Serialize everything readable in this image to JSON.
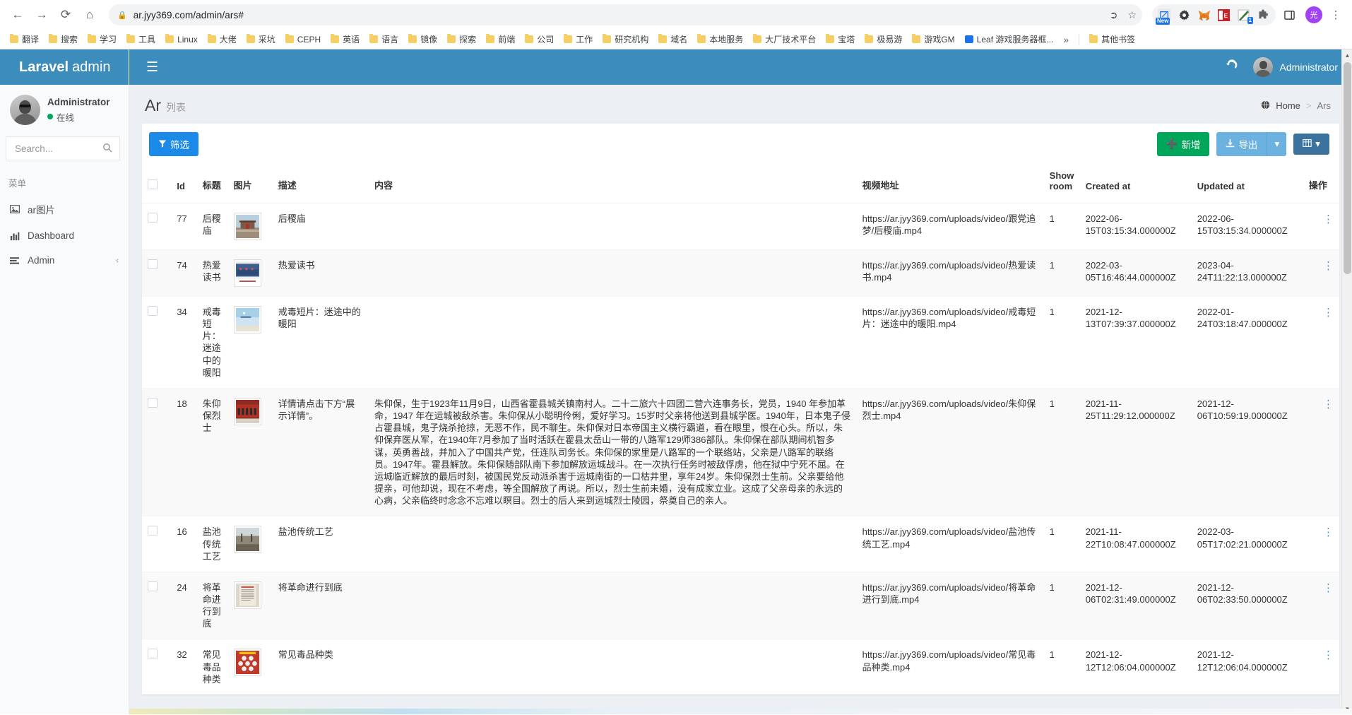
{
  "browser": {
    "url": "ar.jyy369.com/admin/ars#",
    "nav": {
      "back": "←",
      "forward": "→",
      "reload": "⟳",
      "home": "⌂"
    },
    "lock_icon": "lock-icon",
    "share_icon": "share-icon",
    "bookmark_star_icon": "star-icon",
    "extensions": [
      "new-tab-extension",
      "gear-extension",
      "metamask-fox-extension",
      "pdf-extension",
      "marker-extension",
      "puzzle-extension"
    ],
    "sidepanel_icon": "side-panel-icon",
    "profile_initial": "光",
    "menu_icon": "kebab-menu-icon",
    "bookmarks": [
      "翻译",
      "搜索",
      "学习",
      "工具",
      "Linux",
      "大佬",
      "采坑",
      "CEPH",
      "英语",
      "语言",
      "镜像",
      "探索",
      "前端",
      "公司",
      "工作",
      "研究机构",
      "域名",
      "本地服务",
      "大厂技术平台",
      "宝塔",
      "极易游",
      "游戏GM",
      "Leaf 游戏服务器框..."
    ],
    "bookmarks_overflow": "»",
    "other_bookmarks": "其他书签"
  },
  "sidebar": {
    "brand_bold": "Laravel",
    "brand_rest": "admin",
    "user": {
      "name": "Administrator",
      "status": "在线"
    },
    "search": {
      "placeholder": "Search...",
      "value": ""
    },
    "menu_header": "菜单",
    "items": [
      {
        "label": "ar图片",
        "icon": "image-icon",
        "has_children": false
      },
      {
        "label": "Dashboard",
        "icon": "chart-bar-icon",
        "has_children": false
      },
      {
        "label": "Admin",
        "icon": "list-icon",
        "has_children": true
      }
    ]
  },
  "topbar": {
    "hamburger": "☰",
    "refresh_icon": "refresh-icon",
    "username": "Administrator"
  },
  "page": {
    "title": "Ar",
    "subtitle": "列表",
    "breadcrumb": {
      "home": "Home",
      "separator": ">",
      "current": "Ars"
    }
  },
  "toolbar": {
    "filter_label": "筛选",
    "filter_icon": "funnel-icon",
    "add_label": "新增",
    "add_icon": "plus-icon",
    "export_label": "导出",
    "export_icon": "download-icon",
    "export_caret": "▾",
    "grid_icon": "grid-icon",
    "grid_caret": "▾"
  },
  "table": {
    "headers": {
      "select": "",
      "id": "Id",
      "title": "标题",
      "image": "图片",
      "description": "描述",
      "content": "内容",
      "video_url": "视频地址",
      "show_room": "Show room",
      "created_at": "Created at",
      "updated_at": "Updated at",
      "operations": "操作"
    },
    "rows": [
      {
        "id": "77",
        "title": "后稷庙",
        "image": "houji-temple-thumbnail",
        "description": "后稷庙",
        "content": "",
        "video_url": "https://ar.jyy369.com/uploads/video/跟党追梦/后稷庙.mp4",
        "show_room": "1",
        "created_at": "2022-06-15T03:15:34.000000Z",
        "updated_at": "2022-06-15T03:15:34.000000Z",
        "ops": "⋮"
      },
      {
        "id": "74",
        "title": "热爱读书",
        "image": "reading-classroom-thumbnail",
        "description": "热爱读书",
        "content": "",
        "video_url": "https://ar.jyy369.com/uploads/video/热爱读书.mp4",
        "show_room": "1",
        "created_at": "2022-03-05T16:46:44.000000Z",
        "updated_at": "2023-04-24T11:22:13.000000Z",
        "ops": "⋮"
      },
      {
        "id": "34",
        "title": "戒毒短片：迷途中的暖阳",
        "image": "sky-poster-thumbnail",
        "description": "戒毒短片：迷途中的暖阳",
        "content": "",
        "video_url": "https://ar.jyy369.com/uploads/video/戒毒短片：迷途中的暖阳.mp4",
        "show_room": "1",
        "created_at": "2021-12-13T07:39:37.000000Z",
        "updated_at": "2022-01-24T03:18:47.000000Z",
        "ops": "⋮"
      },
      {
        "id": "18",
        "title": "朱仰保烈士",
        "image": "group-photo-thumbnail",
        "description": "详情请点击下方“展示详情”。",
        "content": "朱仰保，生于1923年11月9日，山西省霍县城关镇南村人。二十二旅六十四团二营六连事务长，党员，1940 年参加革命，1947 年在运城被敌杀害。朱仰保从小聪明伶俐，爱好学习。15岁时父亲将他送到县城学医。1940年，日本鬼子侵占霍县城，鬼子烧杀抢掠，无恶不作，民不聊生。朱仰保对日本帝国主义横行霸道，看在眼里，恨在心头。所以，朱仰保弃医从军，在1940年7月参加了当时活跃在霍县太岳山一带的八路军129师386部队。朱仰保在部队期间机智多谋，英勇善战，并加入了中国共产党，任连队司务长。朱仰保的家里是八路军的一个联络站，父亲是八路军的联络员。1947年。霍县解放。朱仰保随部队南下参加解放运城战斗。在一次执行任务时被敌俘虏，他在狱中宁死不屈。在运城临近解放的最后时刻，被国民党反动派杀害于运城南街的一口枯井里，享年24岁。朱仰保烈士生前。父亲要给他提亲，可他却说，现在不考虑，等全国解放了再说。所以，烈士生前未婚，没有成家立业。这成了父亲母亲的永远的心病，父亲临终时念念不忘难以瞑目。烈士的后人来到运城烈士陵园，祭奠自己的亲人。",
        "video_url": "https://ar.jyy369.com/uploads/video/朱仰保烈士.mp4",
        "show_room": "1",
        "created_at": "2021-11-25T11:29:12.000000Z",
        "updated_at": "2021-12-06T10:59:19.000000Z",
        "ops": "⋮"
      },
      {
        "id": "16",
        "title": "盐池传统工艺",
        "image": "salt-lake-thumbnail",
        "description": "盐池传统工艺",
        "content": "",
        "video_url": "https://ar.jyy369.com/uploads/video/盐池传统工艺.mp4",
        "show_room": "1",
        "created_at": "2021-11-22T10:08:47.000000Z",
        "updated_at": "2022-03-05T17:02:21.000000Z",
        "ops": "⋮"
      },
      {
        "id": "24",
        "title": "将革命进行到底",
        "image": "newspaper-thumbnail",
        "description": "将革命进行到底",
        "content": "",
        "video_url": "https://ar.jyy369.com/uploads/video/将革命进行到底.mp4",
        "show_room": "1",
        "created_at": "2021-12-06T02:31:49.000000Z",
        "updated_at": "2021-12-06T02:33:50.000000Z",
        "ops": "⋮"
      },
      {
        "id": "32",
        "title": "常见毒品种类",
        "image": "drug-types-poster-thumbnail",
        "description": "常见毒品种类",
        "content": "",
        "video_url": "https://ar.jyy369.com/uploads/video/常见毒品种类.mp4",
        "show_room": "1",
        "created_at": "2021-12-12T12:06:04.000000Z",
        "updated_at": "2021-12-12T12:06:04.000000Z",
        "ops": "⋮"
      }
    ]
  },
  "colors": {
    "brand_blue": "#3c8dbc",
    "green": "#00a65a",
    "filter_blue": "#1a89e8",
    "export_blue": "#6cb2e0",
    "grid_blue": "#3b739e",
    "page_bg": "#ecf0f5"
  }
}
